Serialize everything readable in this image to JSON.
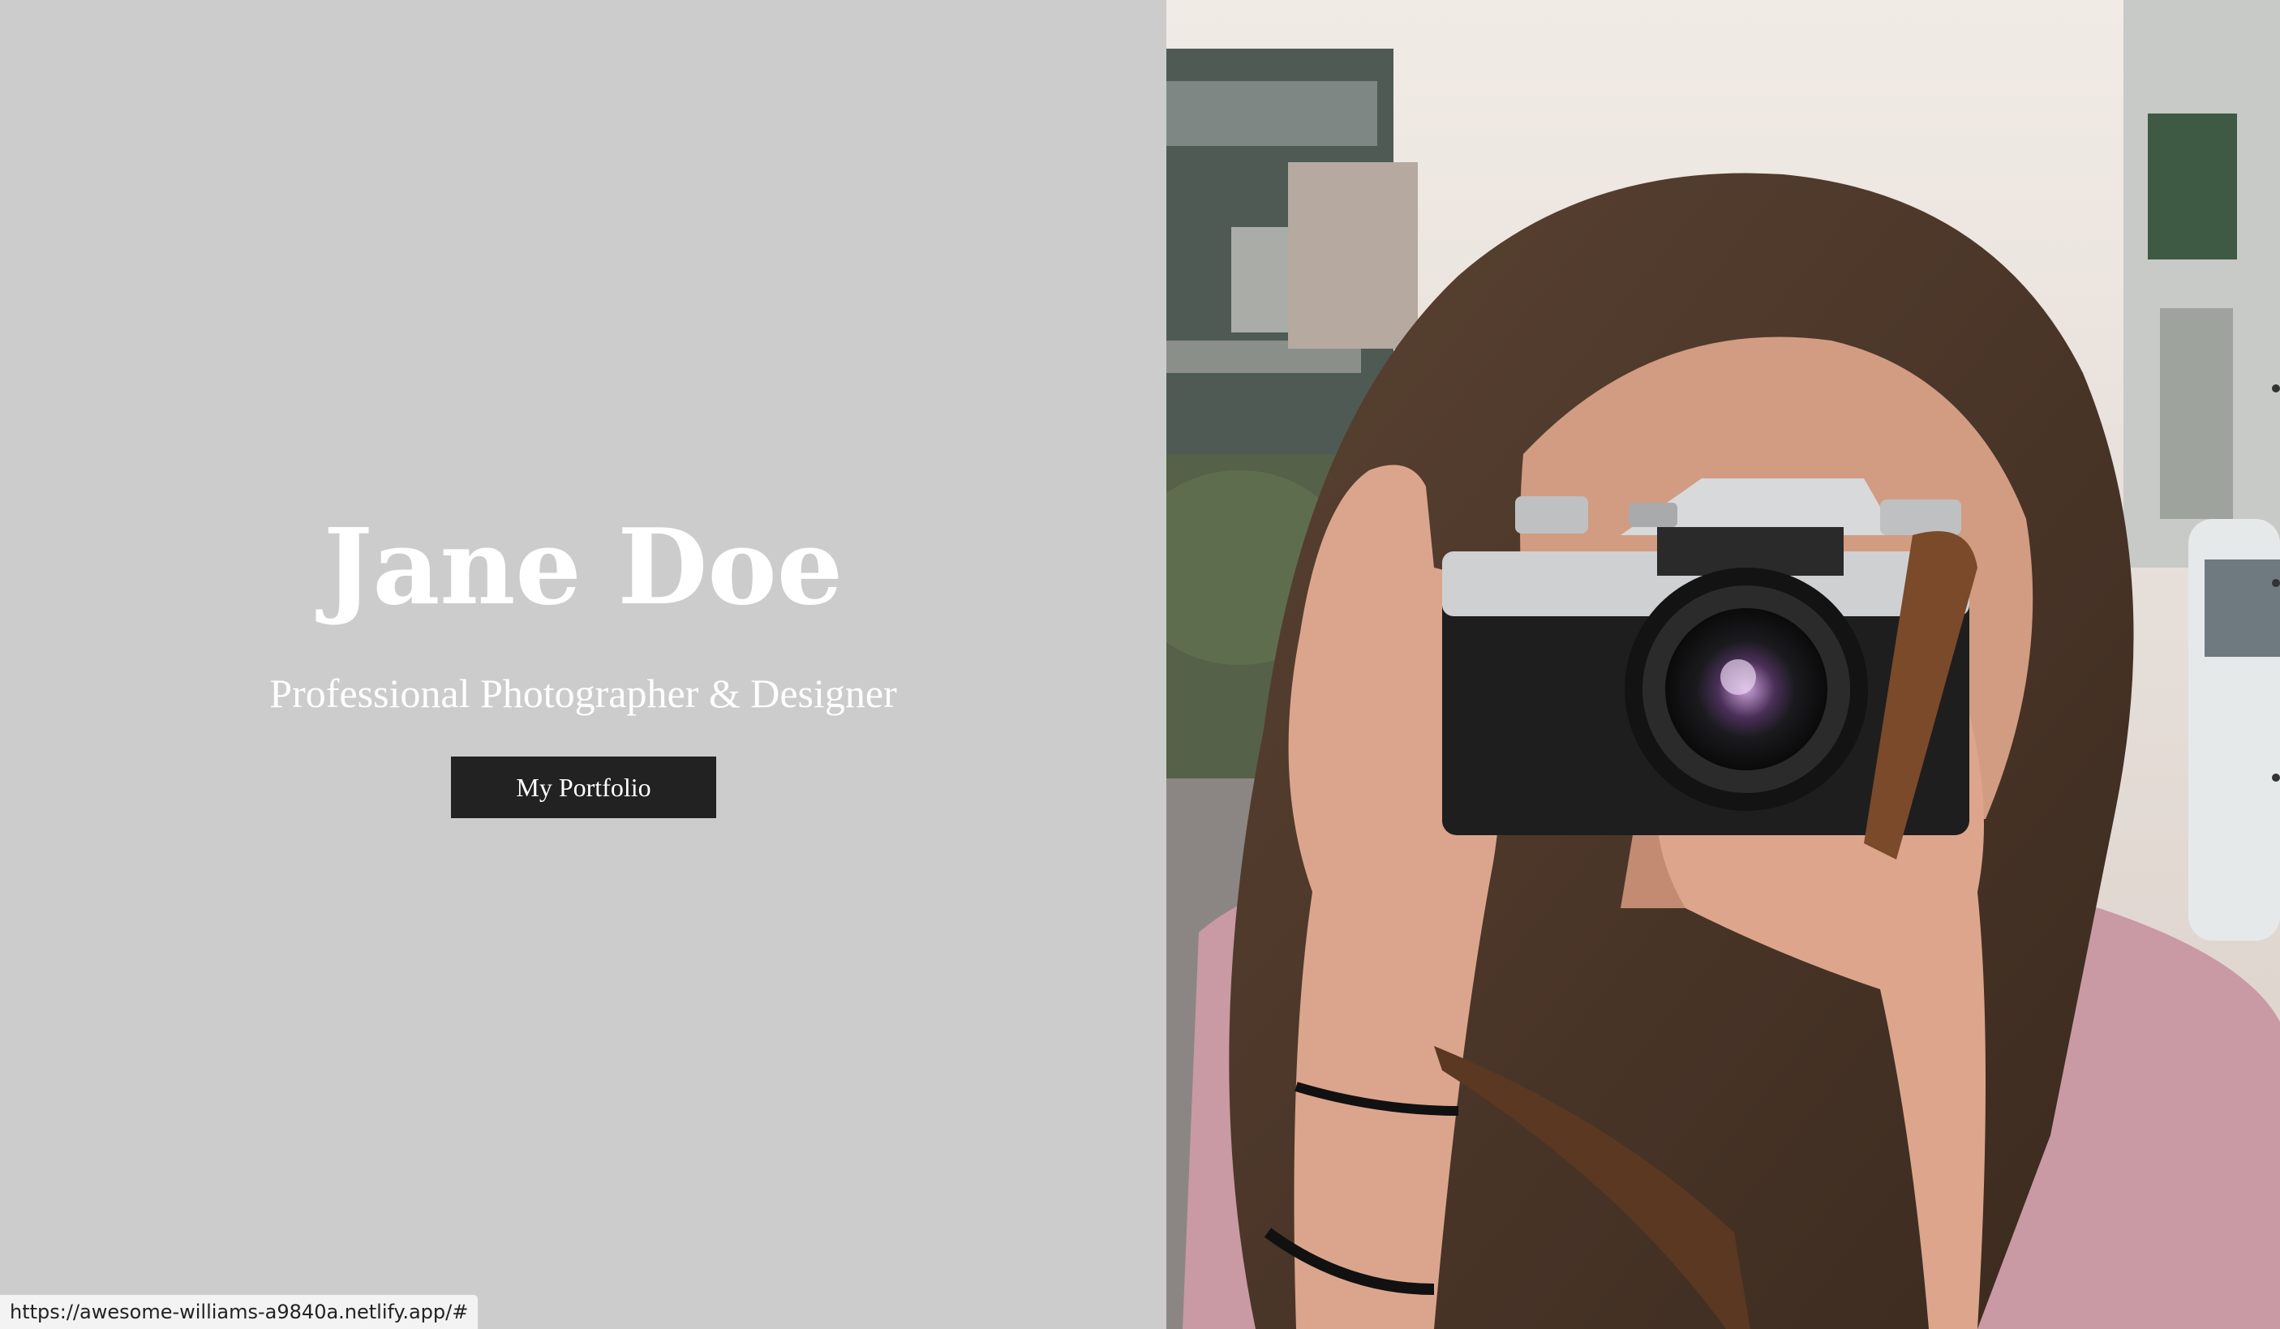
{
  "hero": {
    "title": "Jane Doe",
    "subtitle": "Professional Photographer & Designer",
    "button_label": "My Portfolio"
  },
  "photo": {
    "subject": "photographer-holding-camera"
  },
  "status_bar": {
    "url": "https://awesome-williams-a9840a.netlify.app/#"
  },
  "colors": {
    "left_background": "#cccccc",
    "button_background": "#222222",
    "text": "#ffffff"
  }
}
